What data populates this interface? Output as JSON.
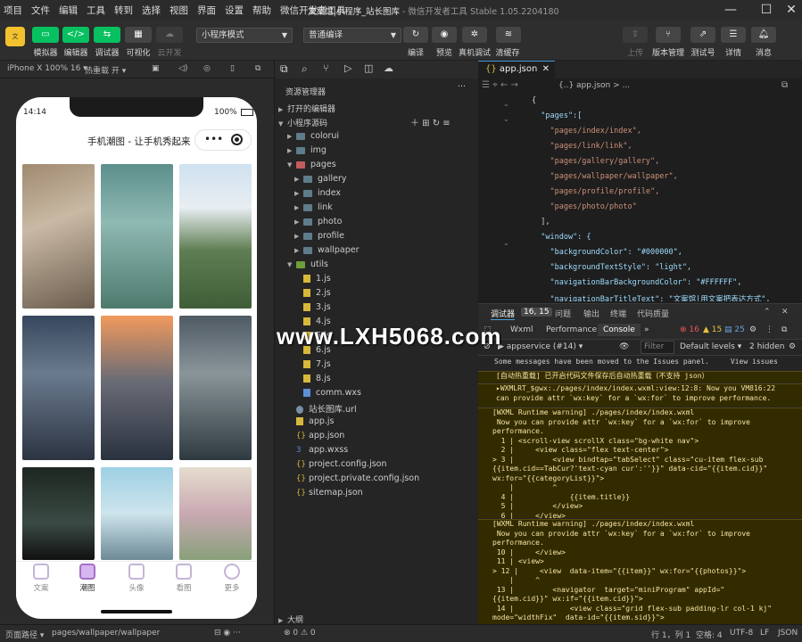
{
  "menu": [
    "项目",
    "文件",
    "编辑",
    "工具",
    "转到",
    "选择",
    "视图",
    "界面",
    "设置",
    "帮助",
    "微信开发者工具"
  ],
  "window_title": "文案馆|小程序_站长图库",
  "window_version": "- 微信开发者工具 Stable 1.05.2204180",
  "toolbar": {
    "simulator": "模拟器",
    "editor": "编辑器",
    "debugger": "调试器",
    "visual": "可视化",
    "cloud": "云开发",
    "mode_select": "小程序模式",
    "compile_select": "普通编译",
    "compile": "编译",
    "preview": "预览",
    "real_debug": "真机调试",
    "clear_cache": "清缓存",
    "upload": "上传",
    "version": "版本管理",
    "test": "测试号",
    "detail": "详情",
    "message": "消息"
  },
  "simbar": {
    "device": "iPhone X 100% 16 ▾",
    "hotreload": "热重载 开 ▾"
  },
  "phone": {
    "time": "14:14",
    "battery": "100%",
    "nav_title": "手机潮图 - 让手机秀起来",
    "tabs": [
      "文案",
      "潮图",
      "头像",
      "看图",
      "更多"
    ]
  },
  "explorer": {
    "title": "资源管理器",
    "open_editors": "打开的编辑器",
    "root": "小程序源码",
    "items": [
      "colorui",
      "img",
      "pages",
      "gallery",
      "index",
      "link",
      "photo",
      "profile",
      "wallpaper",
      "utils",
      "1.js",
      "2.js",
      "3.js",
      "4.js",
      "5.js",
      "6.js",
      "7.js",
      "8.js",
      "comm.wxs",
      "站长图库.url",
      "app.js",
      "app.json",
      "app.wxss",
      "project.config.json",
      "project.private.config.json",
      "sitemap.json"
    ],
    "outline": "大纲"
  },
  "editor": {
    "tab": "app.json",
    "breadcrumb": "{..} app.json > ...",
    "lines": [
      "{",
      "  \"pages\":[",
      "    \"pages/index/index\",",
      "    \"pages/link/link\",",
      "    \"pages/gallery/gallery\",",
      "    \"pages/wallpaper/wallpaper\",",
      "    \"pages/profile/profile\",",
      "    \"pages/photo/photo\"",
      "  ],",
      "  \"window\": {",
      "    \"backgroundColor\": \"#000000\",",
      "    \"backgroundTextStyle\": \"light\",",
      "    \"navigationBarBackgroundColor\": \"#FFFFFF\",",
      "    \"navigationBarTitleText\": \"文案馆|用文案把表达方式\","
    ]
  },
  "console": {
    "tabs": [
      "调试器",
      "16, 15",
      "问题",
      "输出",
      "终端",
      "代码质量"
    ],
    "subtabs": [
      "Wxml",
      "Performance",
      "Console"
    ],
    "errors": "16",
    "warnings": "15",
    "infos": "25",
    "context": "appservice (#14)",
    "filter": "Filter",
    "levels": "Default levels ▾",
    "hidden": "2 hidden",
    "rows": [
      "Some messages have been moved to the Issues panel.     View issues",
      "[自动热重载] 已开启代码文件保存后自动热重载（不支持 json）",
      "▸WXMLRT_$gwx:./pages/index/index.wxml:view:12:8: Now you VM816:22\ncan provide attr `wx:key` for a `wx:for` to improve performance.",
      "[WXML Runtime warning] ./pages/index/index.wxml\n Now you can provide attr `wx:key` for a `wx:for` to improve\nperformance.\n  1 | <scroll-view scrollX class=\"bg-white nav\">\n  2 |     <view class=\"flex text-center\">\n> 3 |         <view bindtap=\"tabSelect\" class=\"cu-item flex-sub\n{{item.cid==TabCur?'text-cyan cur':''}}\" data-cid=\"{{item.cid}}\"\nwx:for=\"{{categoryList}}\">\n    |         ^\n  4 |             {{item.title}}\n  5 |         </view>\n  6 |     </view>",
      "[WXML Runtime warning] ./pages/index/index.wxml\n Now you can provide attr `wx:key` for a `wx:for` to improve\nperformance.\n 10 |     </view>\n 11 | <view>\n> 12 |     <view  data-item=\"{{item}}\" wx:for=\"{{photos}}\">\n    |     ^\n 13 |         <navigator  target=\"miniProgram\" appId=\"\n{{item.cid}}\" wx:if=\"{{item.cid}}\">\n 14 |             <view class=\"grid flex-sub padding-lr col-1 kj\"\nmode=\"widthFix\"  data-id=\"{{item.sid}}\">\n 15 |               <view class=\"ee\">"
    ]
  },
  "status": {
    "path_label": "页面路径 ▾",
    "path": "pages/wallpaper/wallpaper",
    "errs": "⊗ 0 ⚠ 0",
    "cursor": "行 1，列 1",
    "spaces": "空格: 4",
    "encoding": "UTF-8",
    "eol": "LF",
    "lang": "JSON"
  },
  "watermark": "www.LXH5068.com",
  "colors": {
    "accent_green": "#07c160",
    "link_blue": "#4a9eda",
    "warn_bg": "#332b00"
  }
}
